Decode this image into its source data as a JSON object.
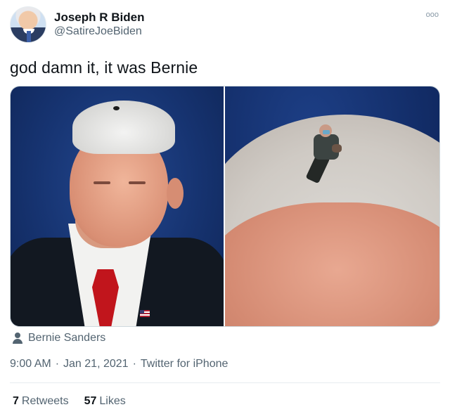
{
  "author": {
    "name": "Joseph R Biden",
    "handle": "@SatireJoeBiden",
    "more_icon": "ooo"
  },
  "tweet": {
    "text": "god damn it, it was Bernie"
  },
  "media": {
    "tagged_person": "Bernie Sanders",
    "tag_icon": "person-icon"
  },
  "meta": {
    "time": "9:00 AM",
    "separator": "·",
    "date": "Jan 21, 2021",
    "client": "Twitter for iPhone"
  },
  "stats": {
    "retweets_count": "7",
    "retweets_label": "Retweets",
    "likes_count": "57",
    "likes_label": "Likes"
  },
  "colors": {
    "text": "#0f1419",
    "secondary": "#536471",
    "border": "#cfd9de",
    "divider": "#e6ecf0"
  }
}
